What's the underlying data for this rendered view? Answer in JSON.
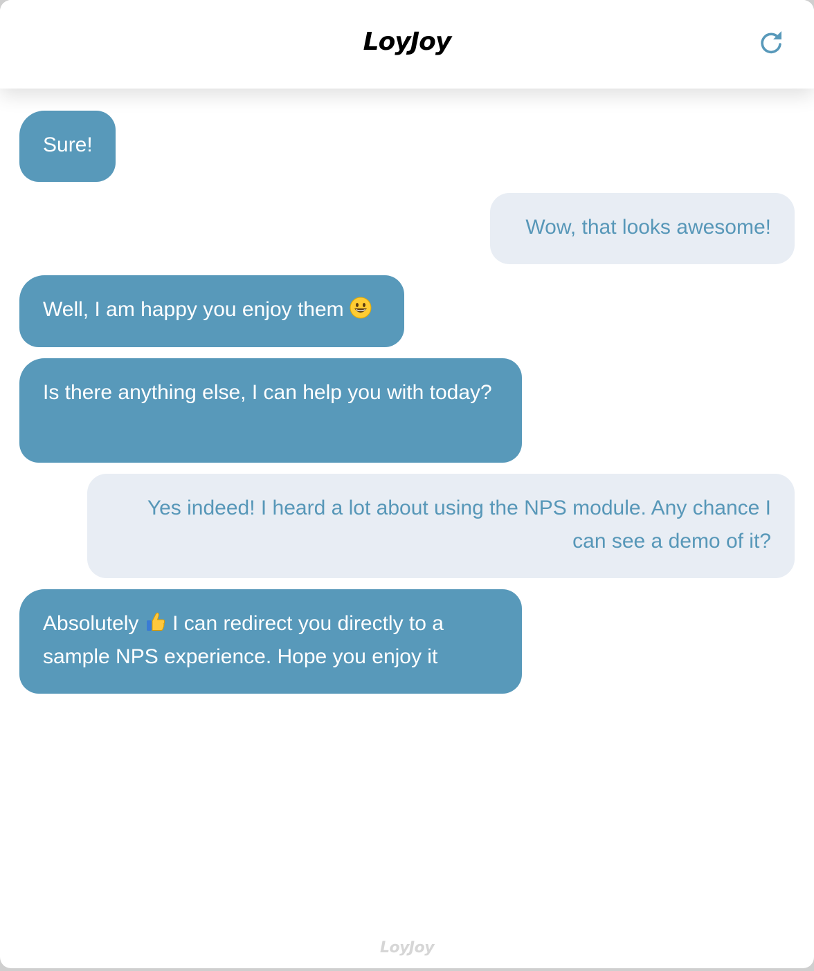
{
  "header": {
    "brand": "LoyJoy",
    "refresh_icon": "refresh-icon"
  },
  "colors": {
    "bot_bubble": "#5899ba",
    "bot_text": "#ffffff",
    "user_bubble": "#e8edf4",
    "user_text": "#5797b8"
  },
  "messages": [
    {
      "sender": "bot",
      "text": "Sure!"
    },
    {
      "sender": "user",
      "text": "Wow, that looks awesome!"
    },
    {
      "sender": "bot",
      "text": "Well, I am happy you enjoy them",
      "emoji": "grinning-face"
    },
    {
      "sender": "bot",
      "text": "Is there anything else, I can help you with today?"
    },
    {
      "sender": "user",
      "text": "Yes indeed! I heard a lot about using the NPS module. Any chance I can see a demo of it?"
    },
    {
      "sender": "bot",
      "text_before": "Absolutely",
      "emoji": "thumbs-up",
      "text_after": "I can redirect you directly to a sample NPS experience. Hope you enjoy it"
    }
  ],
  "footer": {
    "brand": "LoyJoy"
  }
}
